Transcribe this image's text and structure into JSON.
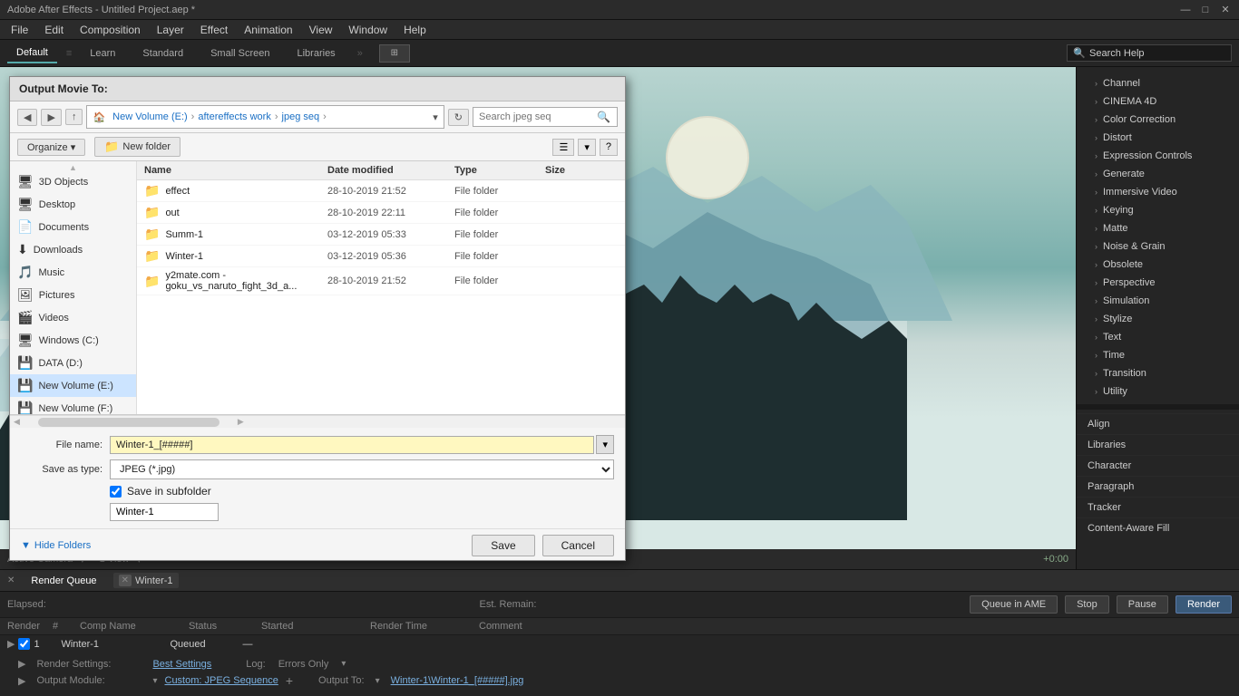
{
  "app": {
    "title": "Adobe After Effects - Untitled Project.aep *",
    "win_controls": [
      "—",
      "□",
      "✕"
    ]
  },
  "menubar": {
    "items": [
      "File",
      "Edit",
      "Composition",
      "Layer",
      "Effect",
      "Animation",
      "View",
      "Window",
      "Help"
    ]
  },
  "workspacebar": {
    "tabs": [
      "Default",
      "Learn",
      "Standard",
      "Small Screen",
      "Libraries"
    ],
    "active_tab": "Default",
    "search_placeholder": "Search Help",
    "search_value": "Search Help"
  },
  "right_panel": {
    "items": [
      "Channel",
      "CINEMA 4D",
      "Color Correction",
      "Distort",
      "Expression Controls",
      "Generate",
      "Immersive Video",
      "Keying",
      "Matte",
      "Noise & Grain",
      "Obsolete",
      "Perspective",
      "Simulation",
      "Stylize",
      "Text",
      "Time",
      "Transition",
      "Utility"
    ],
    "bottom_items": [
      "Align",
      "Libraries",
      "Character",
      "Paragraph",
      "Tracker",
      "Content-Aware Fill"
    ]
  },
  "dialog": {
    "title": "Output Movie To:",
    "breadcrumb": {
      "parts": [
        "New Volume (E:)",
        "aftereffects work",
        "jpeg seq"
      ],
      "separator": "›"
    },
    "search_placeholder": "Search jpeg seq",
    "organize_label": "Organize ▾",
    "new_folder_label": "New folder",
    "columns": {
      "name": "Name",
      "date": "Date modified",
      "type": "Type",
      "size": "Size"
    },
    "files": [
      {
        "icon": "📁",
        "name": "effect",
        "date": "28-10-2019 21:52",
        "type": "File folder",
        "size": ""
      },
      {
        "icon": "📁",
        "name": "out",
        "date": "28-10-2019 22:11",
        "type": "File folder",
        "size": ""
      },
      {
        "icon": "📁",
        "name": "Summ-1",
        "date": "03-12-2019 05:33",
        "type": "File folder",
        "size": ""
      },
      {
        "icon": "📁",
        "name": "Winter-1",
        "date": "03-12-2019 05:36",
        "type": "File folder",
        "size": ""
      },
      {
        "icon": "📁",
        "name": "y2mate.com - goku_vs_naruto_fight_3d_a...",
        "date": "28-10-2019 21:52",
        "type": "File folder",
        "size": ""
      }
    ],
    "file_name_label": "File name:",
    "file_name_value": "Winter-1_[#####]",
    "save_as_label": "Save as type:",
    "save_as_value": "JPEG (*.jpg)",
    "save_in_subfolder": "Save in subfolder",
    "subfolder_name": "Winter-1",
    "hide_folders_label": "Hide Folders",
    "save_label": "Save",
    "cancel_label": "Cancel",
    "nav_items": [
      {
        "icon": "🖥",
        "label": "3D Objects"
      },
      {
        "icon": "🖥",
        "label": "Desktop"
      },
      {
        "icon": "📄",
        "label": "Documents"
      },
      {
        "icon": "⬇",
        "label": "Downloads"
      },
      {
        "icon": "🎵",
        "label": "Music"
      },
      {
        "icon": "🖼",
        "label": "Pictures"
      },
      {
        "icon": "🎬",
        "label": "Videos"
      },
      {
        "icon": "🖥",
        "label": "Windows (C:)"
      },
      {
        "icon": "💾",
        "label": "DATA (D:)"
      },
      {
        "icon": "💾",
        "label": "New Volume (E:)"
      },
      {
        "icon": "💾",
        "label": "New Volume (F:)"
      }
    ]
  },
  "preview": {
    "camera_label": "Active Camera",
    "view_label": "1 View",
    "timecode": "+0:00"
  },
  "render_queue": {
    "tabs": [
      "Render Queue",
      "Winter-1"
    ],
    "elapsed_label": "Elapsed:",
    "est_remain_label": "Est. Remain:",
    "queue_in_ame": "Queue in AME",
    "stop_label": "Stop",
    "pause_label": "Pause",
    "render_label": "Render",
    "columns": [
      "Render",
      "#",
      "Comp Name",
      "Status",
      "Started",
      "Render Time",
      "Comment"
    ],
    "row": {
      "num": "1",
      "comp": "Winter-1",
      "status": "Queued",
      "started": "—",
      "render_time": "",
      "comment": ""
    },
    "render_settings_label": "Render Settings:",
    "best_settings": "Best Settings",
    "output_module_label": "Output Module:",
    "custom_jpeg": "Custom: JPEG Sequence",
    "output_to_label": "Output To:",
    "output_path": "Winter-1\\Winter-1_[#####].jpg",
    "log_label": "Log:",
    "log_value": "Errors Only"
  }
}
